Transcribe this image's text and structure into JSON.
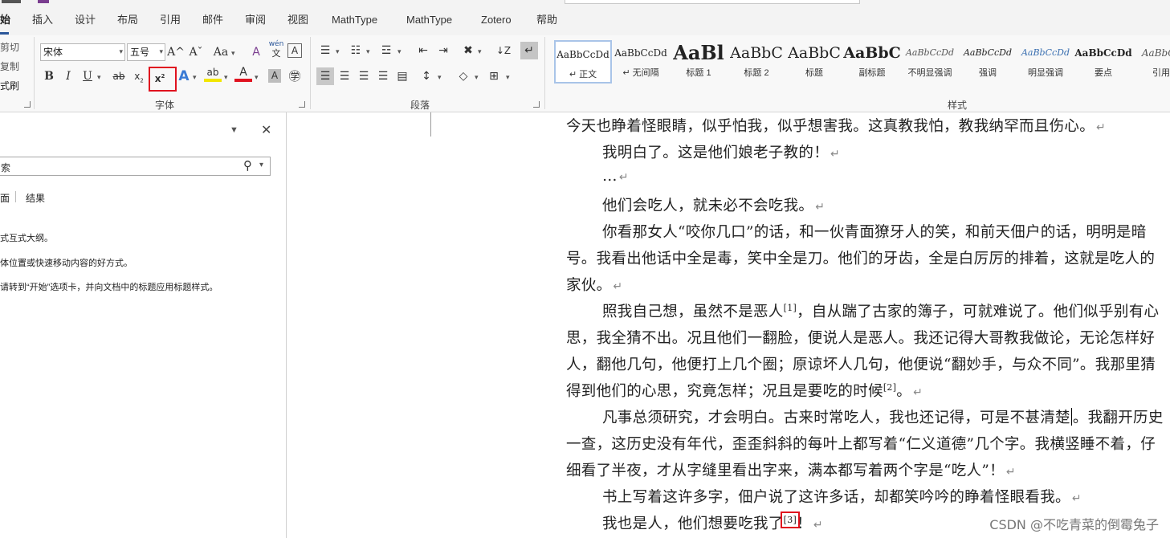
{
  "tabs": [
    {
      "label": "始",
      "active": true
    },
    {
      "label": "插入"
    },
    {
      "label": "设计"
    },
    {
      "label": "布局"
    },
    {
      "label": "引用"
    },
    {
      "label": "邮件"
    },
    {
      "label": "审阅"
    },
    {
      "label": "视图"
    },
    {
      "label": "MathType"
    },
    {
      "label": "MathType"
    },
    {
      "label": "Zotero"
    },
    {
      "label": "帮助"
    }
  ],
  "clipboard": {
    "cut": "剪切",
    "copy": "复制",
    "painter": "式刷"
  },
  "font_group": {
    "label": "字体",
    "font_name": "宋体",
    "font_size": "五号",
    "grow": "A^",
    "shrink": "Aˇ",
    "case": "Aa",
    "bold": "B",
    "italic": "I",
    "underline": "U",
    "strike": "ab",
    "subscript_base": "x",
    "subscript_mark": "2",
    "superscript_base": "x",
    "superscript_mark": "2",
    "text_effects": "A",
    "highlight": "ab",
    "font_color": "A",
    "shade": "A",
    "pinyin_top": "wén",
    "pinyin_bottom": "文",
    "border": "A"
  },
  "paragraph_group": {
    "label": "段落"
  },
  "styles_group": {
    "label": "样式",
    "items": [
      {
        "preview": "AaBbCcDd",
        "name": "↵ 正文",
        "selected": true
      },
      {
        "preview": "AaBbCcDd",
        "name": "↵ 无间隔"
      },
      {
        "preview": "AaBl",
        "name": "标题 1"
      },
      {
        "preview": "AaBbC",
        "name": "标题 2"
      },
      {
        "preview": "AaBbC",
        "name": "标题"
      },
      {
        "preview": "AaBbC",
        "name": "副标题"
      },
      {
        "preview": "AaBbCcDd",
        "name": "不明显强调"
      },
      {
        "preview": "AaBbCcDd",
        "name": "强调"
      },
      {
        "preview": "AaBbCcDd",
        "name": "明显强调"
      },
      {
        "preview": "AaBbCcDd",
        "name": "要点"
      },
      {
        "preview": "AaBbCc",
        "name": "引用"
      }
    ]
  },
  "nav_pane": {
    "search_placeholder": "索",
    "tabs": [
      "面",
      "结果"
    ],
    "lines": [
      "式互式大纲。",
      "体位置或快速移动内容的好方式。",
      "请转到“开始”选项卡，并向文档中的标题应用标题样式。"
    ]
  },
  "document": {
    "para_mark": "↵",
    "lines": [
      {
        "text": "今天也睁着怪眼睛，似乎怕我，似乎想害我。这真教我怕，教我纳罕而且伤心。",
        "mark": true
      },
      {
        "text": "我明白了。这是他们娘老子教的！",
        "mark": true,
        "indent": true
      },
      {
        "text": "…",
        "mark": true,
        "indent": true
      },
      {
        "text": "他们会吃人，就未必不会吃我。",
        "mark": true,
        "indent": true
      },
      {
        "text": "你看那女人“咬你几口”的话，和一伙青面獠牙人的笑，和前天佃户的话，明明是暗",
        "indent": true
      },
      {
        "text": "号。我看出他话中全是毒，笑中全是刀。他们的牙齿，全是白厉厉的排着，这就是吃人的"
      },
      {
        "text": "家伙。",
        "mark": true
      },
      {
        "text_a": "照我自己想，虽然不是恶人",
        "sup": "[1]",
        "text_b": "，自从踹了古家的簿子，可就难说了。他们似乎别有心",
        "indent": true
      },
      {
        "text": "思，我全猜不出。况且他们一翻脸，便说人是恶人。我还记得大哥教我做论，无论怎样好"
      },
      {
        "text": "人，翻他几句，他便打上几个圈；原谅坏人几句，他便说“翻妙手，与众不同”。我那里猜"
      },
      {
        "text_a": "得到他们的心思，究竟怎样；况且是要吃的时候",
        "sup": "[2]",
        "text_b": "。",
        "mark": true
      },
      {
        "text_a": "凡事总须研究，才会明白。古来时常吃人，我也还记得，可是不甚清楚",
        "cursor": true,
        "text_b": "。我翻开历史",
        "indent": true
      },
      {
        "text": "一查，这历史没有年代，歪歪斜斜的每叶上都写着“仁义道德”几个字。我横竖睡不着，仔"
      },
      {
        "text": "细看了半夜，才从字缝里看出字来，满本都写着两个字是“吃人”！",
        "mark": true
      },
      {
        "text": "书上写着这许多字，佃户说了这许多话，却都笑吟吟的睁着怪眼看我。",
        "mark": true,
        "indent": true
      },
      {
        "text_a": "我也是人，他们想要吃我了",
        "sup": "[3]",
        "text_b": "！",
        "mark": true,
        "indent": true,
        "boxed": true
      }
    ]
  },
  "watermark": "CSDN @不吃青菜的倒霉兔子"
}
